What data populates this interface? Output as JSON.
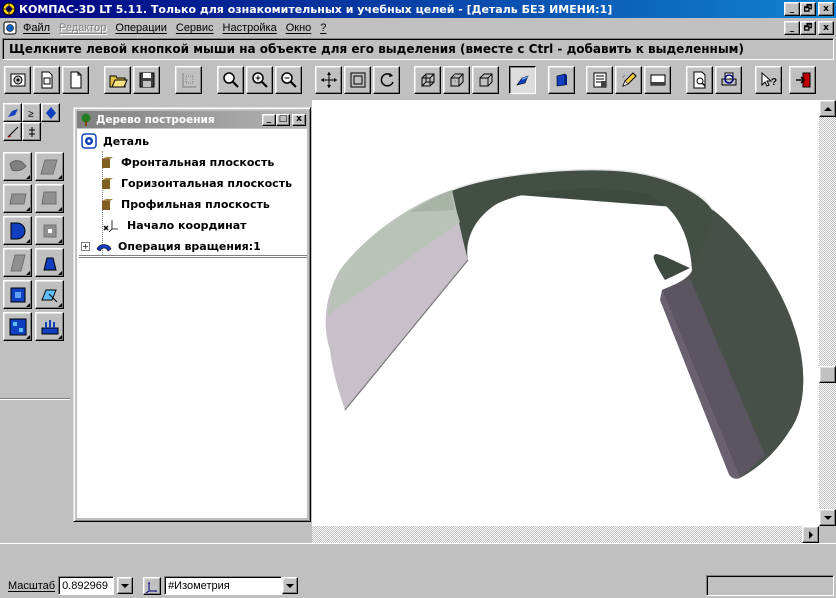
{
  "window": {
    "title": "КОМПАС-3D LT 5.11. Только для ознакомительных и учебных целей - [Деталь БЕЗ ИМЕНИ:1]",
    "caption_buttons": [
      "_",
      "🗗",
      "x"
    ]
  },
  "menu": {
    "items": [
      {
        "label": "Файл",
        "enabled": true
      },
      {
        "label": "Редактор",
        "enabled": false
      },
      {
        "label": "Операции",
        "enabled": true
      },
      {
        "label": "Сервис",
        "enabled": true
      },
      {
        "label": "Настройка",
        "enabled": true
      },
      {
        "label": "Окно",
        "enabled": true
      },
      {
        "label": "?",
        "enabled": true
      }
    ]
  },
  "hint": "Щелкните левой кнопкой мыши на объекте для его выделения (вместе с Ctrl - добавить к выделенным)",
  "toolbar": {
    "buttons": [
      "camera-icon",
      "new-sheet-icon",
      "new-doc-icon",
      "open-icon",
      "save-icon",
      "grid-icon",
      "zoom-icon",
      "zoom-in-icon",
      "zoom-out-icon",
      "pan-icon",
      "zoom-all-icon",
      "rotate-icon",
      "wireframe-icon",
      "hidden-lines-icon",
      "halftone-icon",
      "shaded-icon",
      "perspective-icon",
      "properties-icon",
      "pencil-icon",
      "window-icon",
      "preview-icon",
      "print-icon",
      "help-icon",
      "exit-icon"
    ],
    "pressed": "shaded-icon"
  },
  "tree": {
    "title": "Дерево построения",
    "root": "Деталь",
    "nodes": [
      "Фронтальная плоскость",
      "Горизонтальная плоскость",
      "Профильная плоскость",
      "Начало координат",
      "Операция вращения:1"
    ],
    "expand_glyph": "+"
  },
  "status": {
    "scale_label": "Масштаб",
    "scale_value": "0.892969",
    "view_value": "#Изометрия"
  }
}
